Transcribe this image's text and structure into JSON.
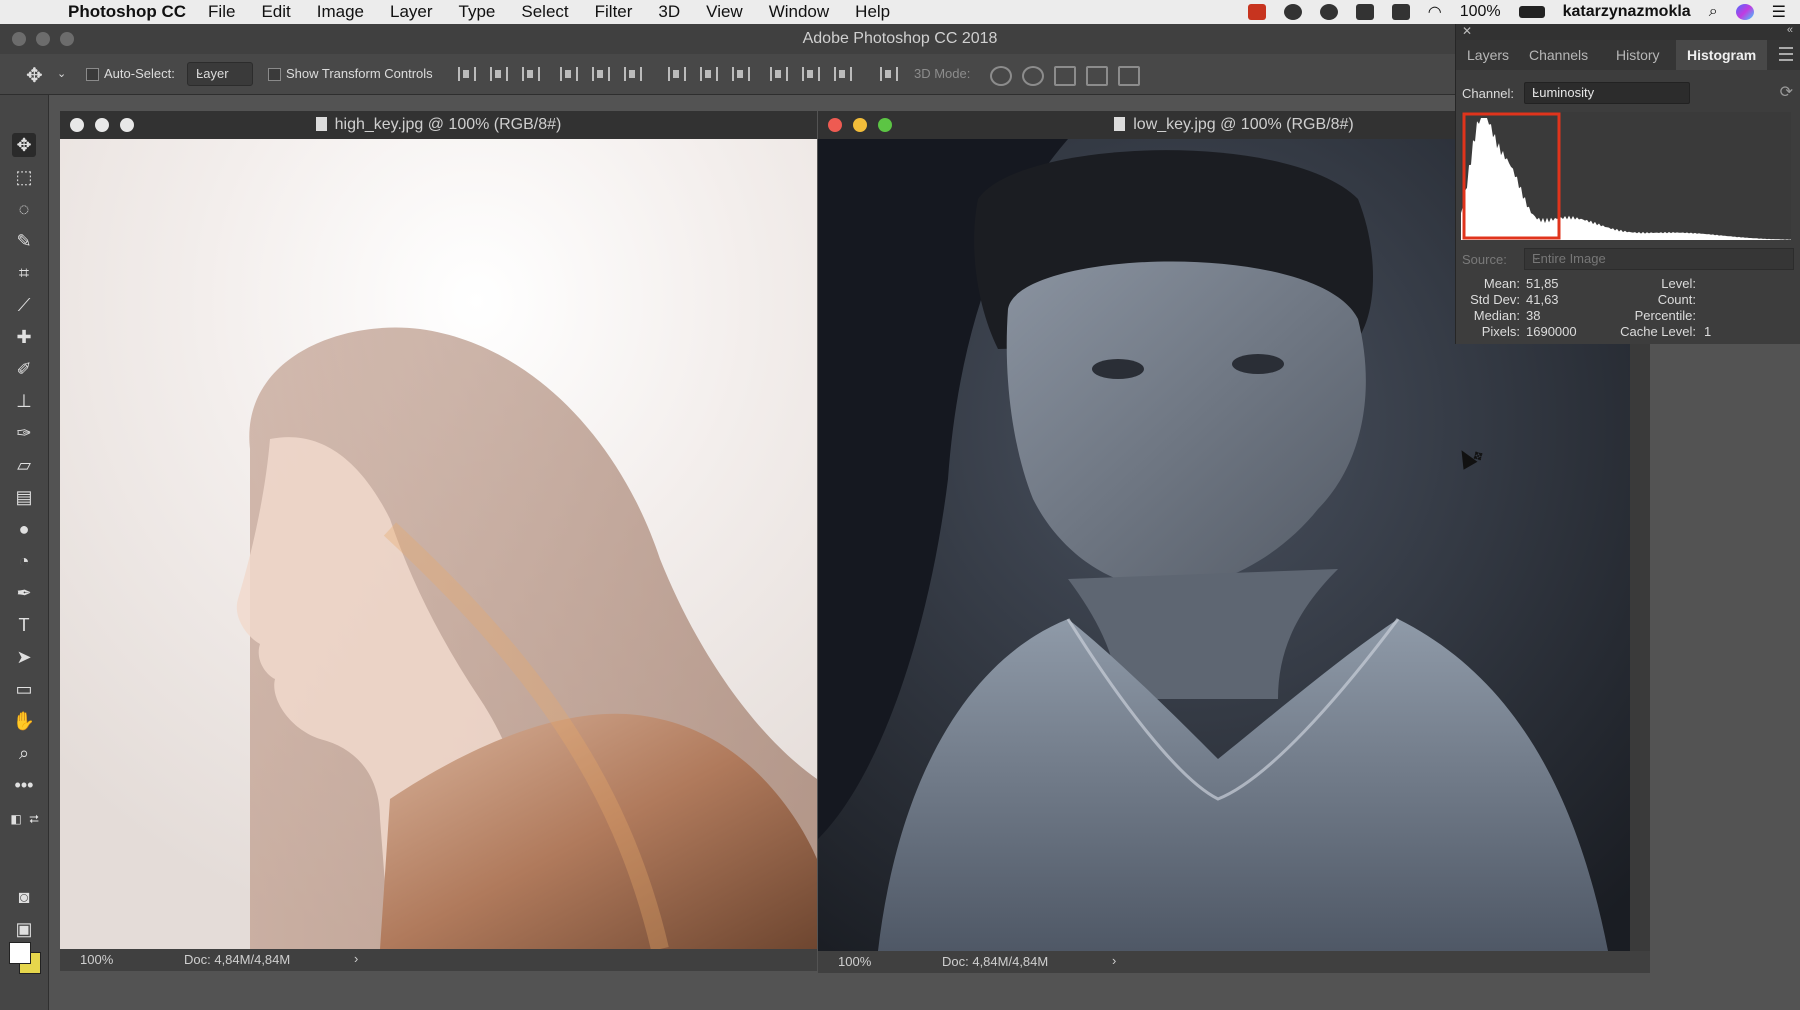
{
  "menubar": {
    "app": "Photoshop CC",
    "items": [
      "File",
      "Edit",
      "Image",
      "Layer",
      "Type",
      "Select",
      "Filter",
      "3D",
      "View",
      "Window",
      "Help"
    ],
    "battery": "100%",
    "user": "katarzynazmokla"
  },
  "window": {
    "title": "Adobe Photoshop CC 2018"
  },
  "options": {
    "auto_select": "Auto-Select:",
    "layer": "Layer",
    "show_transform": "Show Transform Controls",
    "mode3d": "3D Mode:"
  },
  "docs": [
    {
      "title": "high_key.jpg @ 100% (RGB/8#)",
      "zoom": "100%",
      "doc": "Doc: 4,84M/4,84M",
      "arrow": "›"
    },
    {
      "title": "low_key.jpg @ 100% (RGB/8#)",
      "zoom": "100%",
      "doc": "Doc: 4,84M/4,84M",
      "arrow": "›"
    }
  ],
  "panel": {
    "tabs": [
      "Layers",
      "Channels",
      "History",
      "Histogram"
    ],
    "active_tab": "Histogram",
    "channel_label": "Channel:",
    "channel_value": "Luminosity",
    "source_label": "Source:",
    "source_value": "Entire Image",
    "stats_left": [
      {
        "label": "Mean:",
        "value": "51,85"
      },
      {
        "label": "Std Dev:",
        "value": "41,63"
      },
      {
        "label": "Median:",
        "value": "38"
      },
      {
        "label": "Pixels:",
        "value": "1690000"
      }
    ],
    "stats_right": [
      {
        "label": "Level:",
        "value": ""
      },
      {
        "label": "Count:",
        "value": ""
      },
      {
        "label": "Percentile:",
        "value": ""
      },
      {
        "label": "Cache Level:",
        "value": "1"
      }
    ],
    "highlight_color": "#e0341c"
  }
}
